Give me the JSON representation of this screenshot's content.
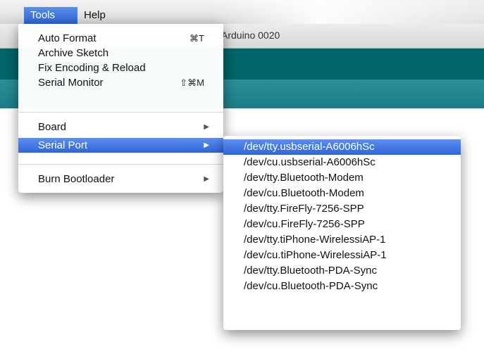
{
  "menubar": {
    "tools_label": "Tools",
    "help_label": "Help"
  },
  "window": {
    "title": "Arduino 0020"
  },
  "tools_menu": {
    "items": [
      {
        "label": "Auto Format",
        "shortcut": "⌘T"
      },
      {
        "label": "Archive Sketch"
      },
      {
        "label": "Fix Encoding & Reload"
      },
      {
        "label": "Serial Monitor",
        "shortcut": "⇧⌘M"
      },
      {
        "label": "Board"
      },
      {
        "label": "Serial Port"
      },
      {
        "label": "Burn Bootloader"
      }
    ],
    "submenu_arrow": "▶"
  },
  "serial_ports": [
    "/dev/tty.usbserial-A6006hSc",
    "/dev/cu.usbserial-A6006hSc",
    "/dev/tty.Bluetooth-Modem",
    "/dev/cu.Bluetooth-Modem",
    "/dev/tty.FireFly-7256-SPP",
    "/dev/cu.FireFly-7256-SPP",
    "/dev/tty.tiPhone-WirelessiAP-1",
    "/dev/cu.tiPhone-WirelessiAP-1",
    "/dev/tty.Bluetooth-PDA-Sync",
    "/dev/cu.Bluetooth-PDA-Sync"
  ],
  "colors": {
    "highlight": "#2f65d8",
    "toolbar": "#006468",
    "tabstrip": "#1c7d88"
  }
}
